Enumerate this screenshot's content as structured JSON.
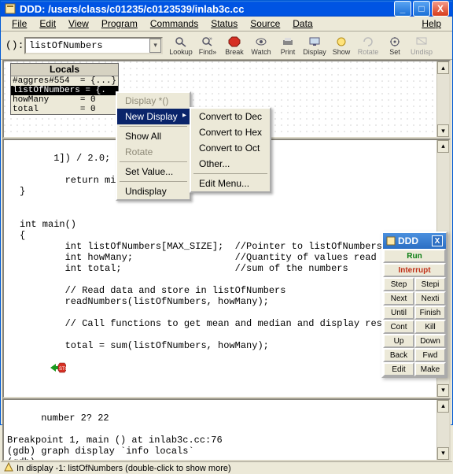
{
  "window": {
    "title": "DDD: /users/class/c01235/c0123539/inlab3c.cc"
  },
  "menubar": {
    "file": "File",
    "edit": "Edit",
    "view": "View",
    "program": "Program",
    "commands": "Commands",
    "status": "Status",
    "source": "Source",
    "data": "Data",
    "help": "Help"
  },
  "toolbar": {
    "arg_label": "():",
    "arg_value": "listOfNumbers",
    "buttons": {
      "lookup": "Lookup",
      "find": "Find»",
      "break": "Break",
      "watch": "Watch",
      "print": "Print",
      "display": "Display",
      "show": "Show",
      "rotate": "Rotate",
      "set": "Set",
      "undisp": "Undisp"
    }
  },
  "locals": {
    "header": "Locals",
    "rows": [
      "#aggres#554  = {...}",
      "listOfNumbers = {.",
      "howMany      = 0",
      "total        = 0"
    ]
  },
  "ctx1": {
    "display_deref": "Display *()",
    "new_display": "New Display",
    "show_all": "Show All",
    "rotate": "Rotate",
    "set_value": "Set Value...",
    "undisplay": "Undisplay"
  },
  "ctx2": {
    "to_dec": "Convert to Dec",
    "to_hex": "Convert to Hex",
    "to_oct": "Convert to Oct",
    "other": "Other...",
    "edit_menu": "Edit Menu..."
  },
  "source": "1]) / 2.0;\n\n        return middl\n}\n\n\nint main()\n{\n        int listOfNumbers[MAX_SIZE];  //Pointer to listOfNumbers to ho\n        int howMany;                  //Quantity of values read\n        int total;                    //sum of the numbers\n\n        // Read data and store in listOfNumbers\n        readNumbers(listOfNumbers, howMany);\n\n        // Call functions to get mean and median and display results.\n\n        total = sum(listOfNumbers, howMany);\n",
  "console": "number 2? 22\n\nBreakpoint 1, main () at inlab3c.cc:76\n(gdb) graph display `info locals`\n(gdb) ",
  "cmdpanel": {
    "title": "DDD",
    "run": "Run",
    "interrupt": "Interrupt",
    "step": "Step",
    "stepi": "Stepi",
    "next": "Next",
    "nexti": "Nexti",
    "until": "Until",
    "finish": "Finish",
    "cont": "Cont",
    "kill": "Kill",
    "up": "Up",
    "down": "Down",
    "back": "Back",
    "fwd": "Fwd",
    "edit": "Edit",
    "make": "Make"
  },
  "statusbar": {
    "text": "In display -1: listOfNumbers (double-click to show more)"
  },
  "glyphs": {
    "min": "_",
    "max": "□",
    "close": "X",
    "drop": "▾",
    "sub_arrow": "▸",
    "up": "▴",
    "down": "▾",
    "stop": "■",
    "green_arrow": "➔"
  }
}
